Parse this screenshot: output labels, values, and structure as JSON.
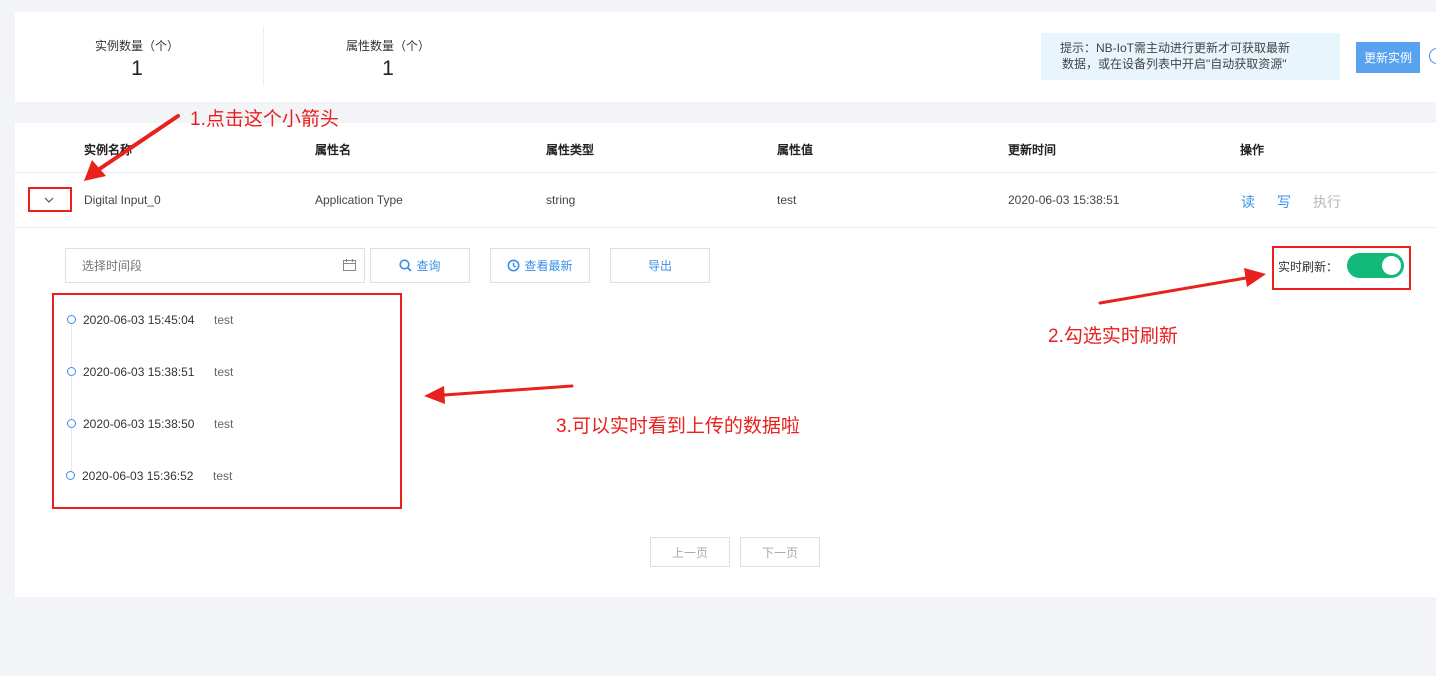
{
  "stats": [
    {
      "label": "实例数量（个）",
      "value": "1"
    },
    {
      "label": "属性数量（个）",
      "value": "1"
    }
  ],
  "tip": {
    "line1": "提示：NB-IoT需主动进行更新才可获取最新",
    "line2": "数据，或在设备列表中开启\"自动获取资源\""
  },
  "update_button": "更新实例",
  "table": {
    "headers": [
      "实例名称",
      "属性名",
      "属性类型",
      "属性值",
      "更新时间",
      "操作"
    ],
    "row": {
      "instance": "Digital Input_0",
      "attr_name": "Application Type",
      "attr_type": "string",
      "attr_value": "test",
      "updated": "2020-06-03 15:38:51",
      "actions": [
        "读",
        "写",
        "执行"
      ]
    }
  },
  "detail": {
    "date_placeholder": "选择时间段",
    "query_label": "查询",
    "latest_label": "查看最新",
    "export_label": "导出",
    "refresh_label": "实时刷新：",
    "refresh_on": true,
    "timeline": [
      {
        "time": "2020-06-03 15:45:04",
        "value": "test"
      },
      {
        "time": "2020-06-03 15:38:51",
        "value": "test"
      },
      {
        "time": "2020-06-03 15:38:50",
        "value": "test"
      },
      {
        "time": "2020-06-03 15:36:52",
        "value": "test"
      }
    ],
    "prev_page": "上一页",
    "next_page": "下一页"
  },
  "annotations": {
    "a1": "1.点击这个小箭头",
    "a2": "2.勾选实时刷新",
    "a3": "3.可以实时看到上传的数据啦"
  },
  "colors": {
    "accent": "#3a8fe8",
    "toggle": "#13b97a",
    "annotation": "#e8211c"
  }
}
